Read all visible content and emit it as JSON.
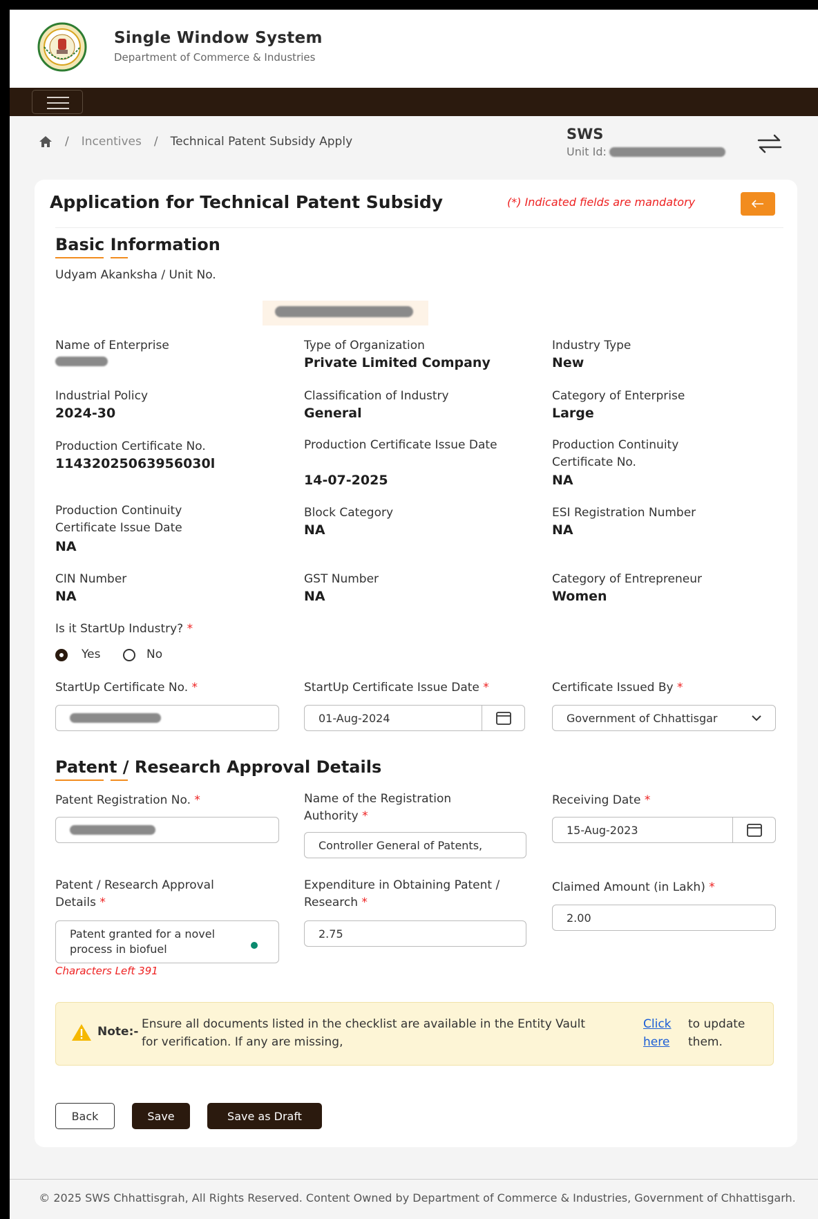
{
  "header": {
    "title": "Single Window System",
    "subtitle": "Department of Commerce & Industries"
  },
  "breadcrumb": {
    "items": [
      "Incentives",
      "Technical Patent Subsidy Apply"
    ]
  },
  "account": {
    "name": "SWS",
    "unit_label": "Unit Id:"
  },
  "form": {
    "title": "Application for Technical Patent Subsidy",
    "mandatory_note": "(*) Indicated fields are mandatory",
    "basic_section": "Basic Information",
    "udyam_label": "Udyam Akanksha / Unit No.",
    "fields": [
      {
        "label": "Name of Enterprise",
        "value": ""
      },
      {
        "label": "Type of Organization",
        "value": "Private Limited Company"
      },
      {
        "label": "Industry Type",
        "value": "New"
      },
      {
        "label": "Industrial Policy",
        "value": "2024-30"
      },
      {
        "label": "Classification of Industry",
        "value": "General"
      },
      {
        "label": "Category of Enterprise",
        "value": "Large"
      },
      {
        "label": "Production Certificate No.",
        "value": "11432025063956030l"
      },
      {
        "label": "Production Certificate Issue Date",
        "value": "14-07-2025"
      },
      {
        "label": "Production Continuity Certificate No.",
        "value": "NA"
      },
      {
        "label": "Production Continuity Certificate Issue Date",
        "value": "NA"
      },
      {
        "label": "Block Category",
        "value": "NA"
      },
      {
        "label": "ESI Registration Number",
        "value": "NA"
      },
      {
        "label": "CIN Number",
        "value": "NA"
      },
      {
        "label": "GST Number",
        "value": "NA"
      },
      {
        "label": "Category of Entrepreneur",
        "value": "Women"
      }
    ],
    "startup_question": "Is it StartUp Industry?",
    "radio_yes": "Yes",
    "radio_no": "No",
    "startup_cert_label": "StartUp Certificate No.",
    "startup_date_label": "StartUp Certificate Issue Date",
    "startup_date_value": "01-Aug-2024",
    "issued_by_label": "Certificate Issued By",
    "issued_by_value": "Government of Chhattisgar",
    "patent_section": "Patent / Research Approval Details",
    "patent_reg_label": "Patent Registration No.",
    "authority_label": "Name of the Registration Authority",
    "authority_value": "Controller General of Patents,",
    "receiving_label": "Receiving Date",
    "receiving_value": "15-Aug-2023",
    "approval_label": "Patent / Research Approval Details",
    "approval_value": "Patent granted for a novel process in biofuel",
    "chars_left": "Characters Left 391",
    "expenditure_label": "Expenditure in Obtaining Patent / Research",
    "expenditure_value": "2.75",
    "claimed_label": "Claimed Amount (in Lakh)",
    "claimed_value": "2.00"
  },
  "note": {
    "heading": "Note:-",
    "text": "Ensure all documents listed in the checklist are available in the Entity Vault for verification. If any are missing,",
    "link": "Click here",
    "suffix": "to update them."
  },
  "buttons": {
    "back": "Back",
    "save": "Save",
    "draft": "Save as Draft"
  },
  "footer": "© 2025 SWS Chhattisgrah, All Rights Reserved. Content Owned by Department of Commerce & Industries, Government of Chhattisgarh."
}
